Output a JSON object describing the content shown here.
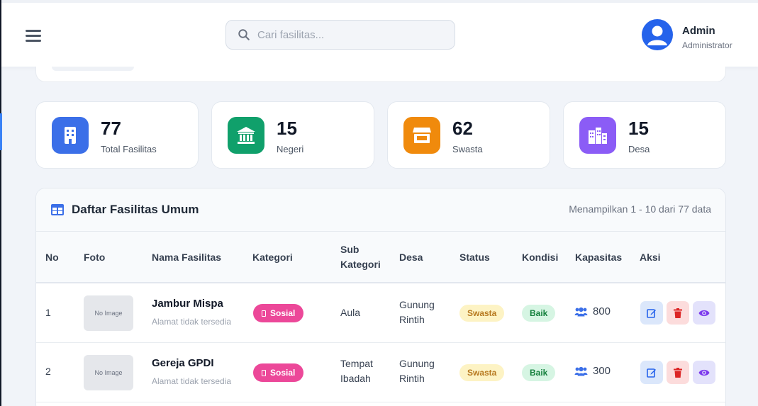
{
  "header": {
    "search_placeholder": "Cari fasilitas...",
    "user_name": "Admin",
    "user_role": "Administrator"
  },
  "stats": [
    {
      "value": "77",
      "label": "Total Fasilitas",
      "color": "#3b6fe8",
      "icon": "building-icon"
    },
    {
      "value": "15",
      "label": "Negeri",
      "color": "#10a06b",
      "icon": "landmark-icon"
    },
    {
      "value": "62",
      "label": "Swasta",
      "color": "#f08a0c",
      "icon": "store-icon"
    },
    {
      "value": "15",
      "label": "Desa",
      "color": "#8b5cf6",
      "icon": "city-icon"
    }
  ],
  "table": {
    "title": "Daftar Fasilitas Umum",
    "info": "Menampilkan 1 - 10 dari 77 data",
    "columns": [
      "No",
      "Foto",
      "Nama Fasilitas",
      "Kategori",
      "Sub Kategori",
      "Desa",
      "Status",
      "Kondisi",
      "Kapasitas",
      "Aksi"
    ],
    "rows": [
      {
        "no": "1",
        "foto": "No Image",
        "nama": "Jambur Mispa",
        "alamat": "Alamat tidak tersedia",
        "kategori": "Sosial",
        "sub_kategori": "Aula",
        "desa": "Gunung Rintih",
        "status": "Swasta",
        "kondisi": "Baik",
        "kapasitas": "800"
      },
      {
        "no": "2",
        "foto": "No Image",
        "nama": "Gereja GPDI",
        "alamat": "Alamat tidak tersedia",
        "kategori": "Sosial",
        "sub_kategori": "Tempat Ibadah",
        "desa": "Gunung Rintih",
        "status": "Swasta",
        "kondisi": "Baik",
        "kapasitas": "300"
      }
    ]
  },
  "colors": {
    "accent": "#2563eb",
    "kategori_badge": "#ec4899",
    "status_badge_bg": "#fdf3c4",
    "kondisi_badge_bg": "#d6f5e3"
  }
}
